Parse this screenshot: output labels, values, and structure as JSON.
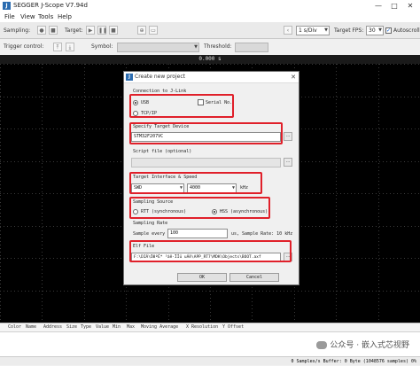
{
  "window": {
    "title": "SEGGER J-Scope V7.94d",
    "logo_text": "J",
    "controls": [
      "—",
      "□",
      "✕"
    ]
  },
  "menu": {
    "items": [
      "File",
      "View",
      "Tools",
      "Help"
    ]
  },
  "toolbar": {
    "sampling_label": "Sampling:",
    "target_label": "Target:",
    "timebase": "1 s/Div",
    "target_fps_label": "Target FPS:",
    "target_fps_value": "30",
    "autoscroll_label": "Autoscroll",
    "autoscroll_checked": true
  },
  "trigger": {
    "control_label": "Trigger control:",
    "symbol_label": "Symbol:",
    "threshold_label": "Threshold:"
  },
  "scope": {
    "time_readout": "0.000 s",
    "background": "#000000",
    "grid_color": "#3a3a3a"
  },
  "table": {
    "columns": [
      "Color",
      "Name",
      "Address",
      "Size",
      "Type",
      "Value",
      "Min",
      "Max",
      "Moving Average",
      "X Resolution",
      "Y Offset"
    ]
  },
  "status": {
    "text": "0 Samples/s Buffer: 0 Byte (1048576 samples) 0%"
  },
  "watermark": {
    "text": "公众号 · 嵌入式芯视野"
  },
  "dialog": {
    "title": "Create new project",
    "close_glyph": "✕",
    "connection": {
      "label": "Connection to J-Link",
      "usb_label": "USB",
      "tcpip_label": "TCP/IP",
      "serial_label": "Serial No.",
      "selected": "USB"
    },
    "device": {
      "label": "Specify Target Device",
      "value": "STM32F207VC",
      "button": "..."
    },
    "script": {
      "label": "Script file (optional)",
      "value": "",
      "button": "..."
    },
    "interface": {
      "label": "Target Interface & Speed",
      "interface_value": "SWD",
      "speed_value": "4000",
      "unit": "kHz"
    },
    "sampling_source": {
      "label": "Sampling Source",
      "rtt_label": "RTT (synchronous)",
      "hss_label": "HSS (asynchronous)",
      "selected": "HSS"
    },
    "sampling_rate": {
      "label": "Sampling Rate",
      "sample_every_label": "Sample every",
      "sample_every_value": "100",
      "units_text": "us, Sample Rate: 10 kHz"
    },
    "elf": {
      "label": "Elf File",
      "value": "F:\\DIÁ\\Ö8ºÈ* ³áê·ÏÍü uÁê\\APP_RT7\\MDK\\Objects\\BOOT.axf",
      "button": "..."
    },
    "buttons": {
      "ok": "OK",
      "cancel": "Cancel"
    },
    "highlight_color": "#e0202a"
  }
}
